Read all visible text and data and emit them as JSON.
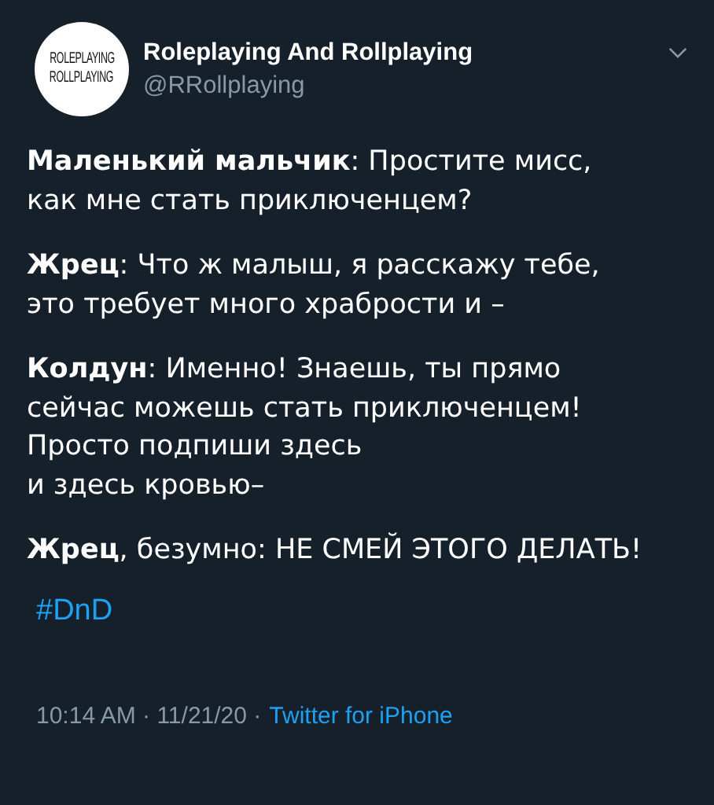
{
  "author": {
    "avatar_text": [
      "ROLEPLAYING",
      "ROLLPLAYING"
    ],
    "name": "Roleplaying And Rollplaying",
    "handle": "@RRollplaying"
  },
  "paragraphs": [
    {
      "lines": [
        "**Маленький мальчик**: Простите мисс,",
        "как мне стать приключенцем?"
      ]
    },
    {
      "lines": [
        "**Жрец**: Что ж малыш, я расскажу тебе,",
        "это требует много храбрости и –"
      ]
    },
    {
      "lines": [
        "**Колдун**: Именно! Знаешь, ты прямо",
        "сейчас можешь стать приключенцем!",
        "Просто подпиши здесь",
        "и здесь кровью–"
      ]
    },
    {
      "lines": [
        "**Жрец**, безумно: НЕ СМЕЙ ЭТОГО ДЕЛАТЬ!"
      ]
    }
  ],
  "hashtag": "#DnD",
  "footer": {
    "time": "10:14 AM · 11/21/20 ·",
    "source": "Twitter for iPhone"
  }
}
